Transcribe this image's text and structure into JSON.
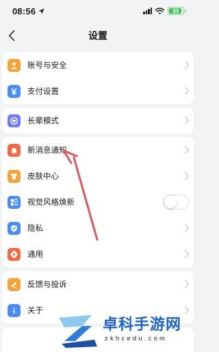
{
  "status": {
    "time": "08:56",
    "battery": "89"
  },
  "nav": {
    "title": "设置"
  },
  "groups": [
    {
      "items": [
        {
          "label": "账号与安全",
          "icon": "person-icon",
          "color": "#f5a23a"
        },
        {
          "label": "支付设置",
          "icon": "yen-icon",
          "color": "#4a8cf0"
        }
      ]
    },
    {
      "items": [
        {
          "label": "长辈模式",
          "icon": "elder-mode-icon",
          "color": "#6f7df5"
        }
      ]
    },
    {
      "items": [
        {
          "label": "新消息通知",
          "icon": "bell-icon",
          "color": "#f06b45"
        },
        {
          "label": "皮肤中心",
          "icon": "shirt-icon",
          "color": "#f5a23a"
        },
        {
          "label": "视觉风格焕新",
          "icon": "new-style-icon",
          "color": "#4a8cf0",
          "toggle": false
        },
        {
          "label": "隐私",
          "icon": "shield-icon",
          "color": "#4a8cf0"
        },
        {
          "label": "通用",
          "icon": "gear-icon",
          "color": "#f06b45"
        }
      ]
    },
    {
      "items": [
        {
          "label": "反馈与投诉",
          "icon": "pencil-icon",
          "color": "#f5a23a"
        },
        {
          "label": "关于",
          "icon": "info-icon",
          "color": "#4a8cf0"
        }
      ]
    }
  ],
  "annotation_color": "#e0555a",
  "watermark": {
    "brand": "卓科手游网",
    "domain": "zkhcedu.com",
    "color": "#1e63c4"
  }
}
